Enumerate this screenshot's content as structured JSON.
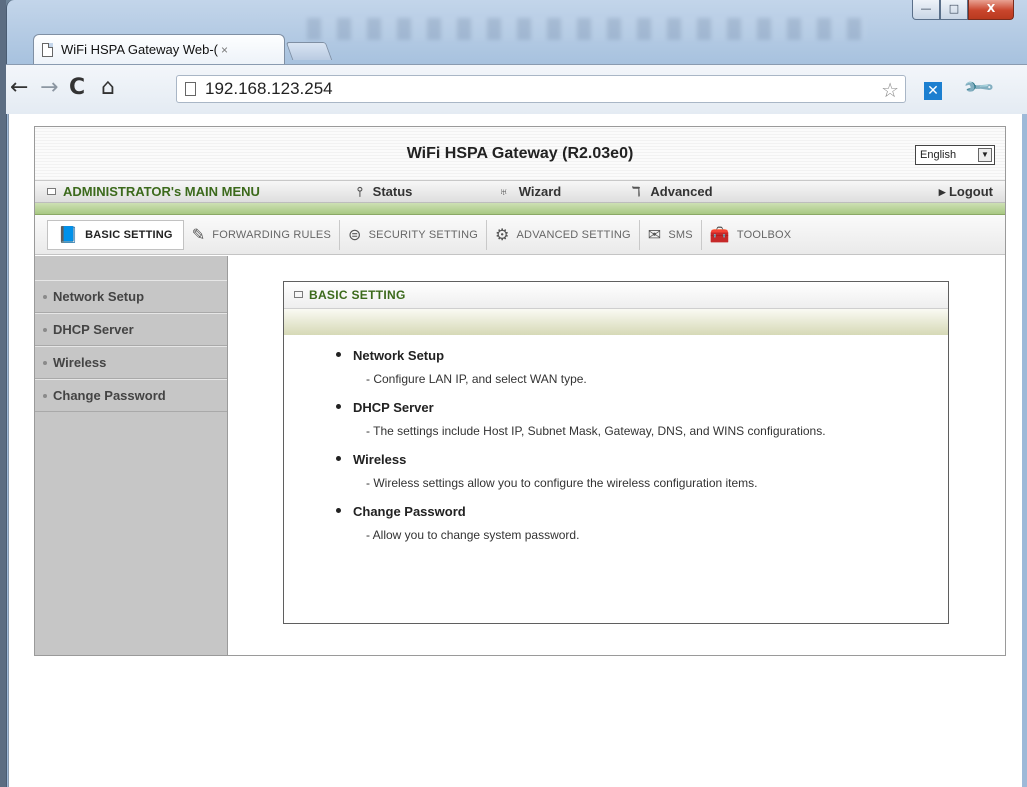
{
  "browser": {
    "tab_title": "WiFi HSPA Gateway Web-(",
    "tab_close": "×",
    "url": "192.168.123.254",
    "window_controls": {
      "minimize": "—",
      "maximize": "□",
      "close": "X"
    },
    "icons": {
      "back": "←",
      "forward": "→",
      "reload": "C",
      "home": "⌂",
      "star": "☆",
      "extension": "✕",
      "wrench": "🔧"
    }
  },
  "router": {
    "title": "WiFi HSPA Gateway   (R2.03e0)",
    "language": "English",
    "menu": {
      "admin_label": "ADMINISTRATOR's MAIN MENU",
      "status": "Status",
      "wizard": "Wizard",
      "advanced": "Advanced",
      "logout": "▸ Logout"
    },
    "tabs": [
      {
        "label": "BASIC SETTING",
        "icon": "book-icon",
        "glyph": "📘"
      },
      {
        "label": "FORWARDING RULES",
        "icon": "pen-icon",
        "glyph": "✎"
      },
      {
        "label": "SECURITY SETTING",
        "icon": "shield-icon",
        "glyph": "⊜"
      },
      {
        "label": "ADVANCED SETTING",
        "icon": "tools-icon",
        "glyph": "⚙"
      },
      {
        "label": "SMS",
        "icon": "envelope-icon",
        "glyph": "✉"
      },
      {
        "label": "TOOLBOX",
        "icon": "toolbox-icon",
        "glyph": "🧰"
      }
    ],
    "sidebar": [
      {
        "label": "Network Setup"
      },
      {
        "label": "DHCP Server"
      },
      {
        "label": "Wireless"
      },
      {
        "label": "Change Password"
      }
    ],
    "panel": {
      "title": "BASIC SETTING",
      "sections": [
        {
          "heading": "Network Setup",
          "desc": "- Configure LAN IP, and select WAN type."
        },
        {
          "heading": "DHCP Server",
          "desc": "- The settings include Host IP, Subnet Mask, Gateway, DNS, and WINS configurations."
        },
        {
          "heading": "Wireless",
          "desc": "- Wireless settings allow you to configure the wireless configuration items."
        },
        {
          "heading": "Change Password",
          "desc": "- Allow you to change system password."
        }
      ]
    }
  },
  "colors": {
    "menu_green": "#3c6a1c",
    "green_band": "#a8c883"
  }
}
